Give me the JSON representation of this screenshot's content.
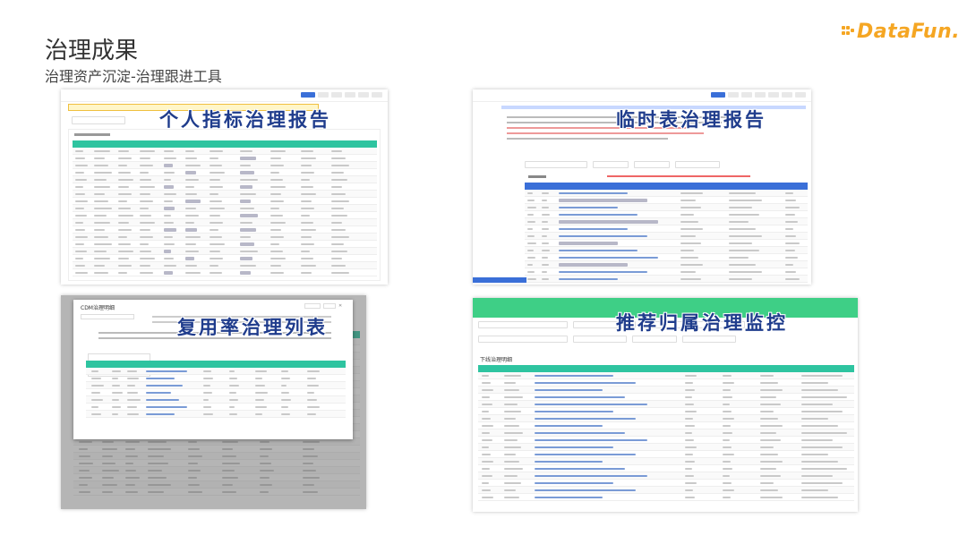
{
  "slide": {
    "title": "治理成果",
    "subtitle": "治理资产沉淀-治理跟进工具",
    "logo_text": "DataFun."
  },
  "panels": [
    {
      "label": "个人指标治理报告",
      "accent": "#2ec4a0"
    },
    {
      "label": "临时表治理报告",
      "accent": "#3a6fd8"
    },
    {
      "label": "复用率治理列表",
      "accent": "#2ec4a0",
      "modal_title": "CDM治理明细"
    },
    {
      "label": "推荐归属治理监控",
      "accent": "#3ecf86",
      "section_title": "下线治理明细"
    }
  ],
  "colors": {
    "brand": "#f5a623",
    "label": "#1f3c8c",
    "table_header": "#2ec4a0"
  }
}
